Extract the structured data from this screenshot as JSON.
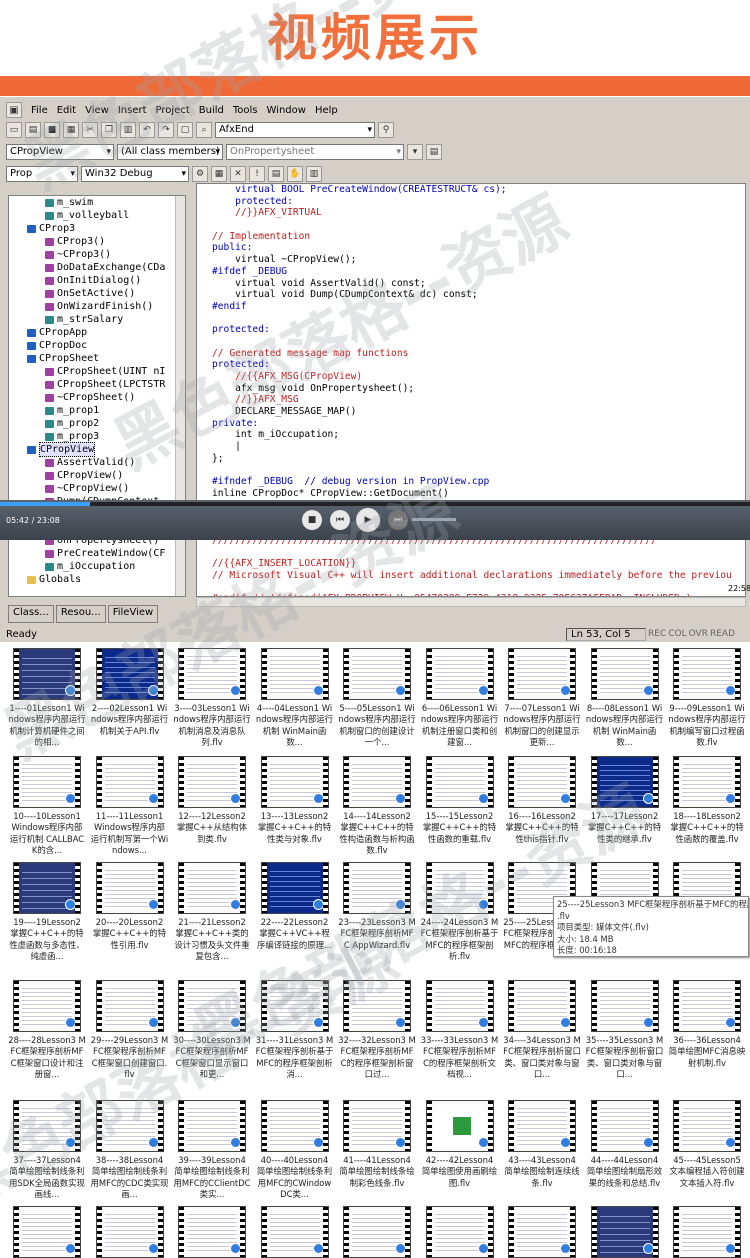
{
  "banner": {
    "title": "视频展示"
  },
  "ide": {
    "menu": [
      "File",
      "Edit",
      "View",
      "Insert",
      "Project",
      "Build",
      "Tools",
      "Window",
      "Help"
    ],
    "find_combo": "AfxEnd",
    "class_combo": "CPropView",
    "members_combo": "(All class members)",
    "function_combo": "OnPropertysheet",
    "project_combo": "Prop",
    "config_combo": "Win32 Debug",
    "tree": [
      {
        "label": "m_swim",
        "indent": 4,
        "icon": "fld"
      },
      {
        "label": "m_volleyball",
        "indent": 4,
        "icon": "fld"
      },
      {
        "label": "CProp3",
        "indent": 2,
        "icon": "cls"
      },
      {
        "label": "CProp3()",
        "indent": 4,
        "icon": "fn"
      },
      {
        "label": "~CProp3()",
        "indent": 4,
        "icon": "fn"
      },
      {
        "label": "DoDataExchange(CDa",
        "indent": 4,
        "icon": "fn"
      },
      {
        "label": "OnInitDialog()",
        "indent": 4,
        "icon": "fn"
      },
      {
        "label": "OnSetActive()",
        "indent": 4,
        "icon": "fn"
      },
      {
        "label": "OnWizardFinish()",
        "indent": 4,
        "icon": "fn"
      },
      {
        "label": "m_strSalary",
        "indent": 4,
        "icon": "fld"
      },
      {
        "label": "CPropApp",
        "indent": 2,
        "icon": "cls"
      },
      {
        "label": "CPropDoc",
        "indent": 2,
        "icon": "cls"
      },
      {
        "label": "CPropSheet",
        "indent": 2,
        "icon": "cls"
      },
      {
        "label": "CPropSheet(UINT nI",
        "indent": 4,
        "icon": "fn"
      },
      {
        "label": "CPropSheet(LPCTSTR",
        "indent": 4,
        "icon": "fn"
      },
      {
        "label": "~CPropSheet()",
        "indent": 4,
        "icon": "fn"
      },
      {
        "label": "m_prop1",
        "indent": 4,
        "icon": "fld"
      },
      {
        "label": "m_prop2",
        "indent": 4,
        "icon": "fld"
      },
      {
        "label": "m_prop3",
        "indent": 4,
        "icon": "fld"
      },
      {
        "label": "CPropView",
        "indent": 2,
        "icon": "cls",
        "selected": true
      },
      {
        "label": "AssertValid()",
        "indent": 4,
        "icon": "fn"
      },
      {
        "label": "CPropView()",
        "indent": 4,
        "icon": "fn"
      },
      {
        "label": "~CPropView()",
        "indent": 4,
        "icon": "fn"
      },
      {
        "label": "Dump(CDumpContext",
        "indent": 4,
        "icon": "fn"
      },
      {
        "label": "GetDocument()",
        "indent": 4,
        "icon": "fn"
      },
      {
        "label": "OnDraw(CDC *pDC)",
        "indent": 4,
        "icon": "fn"
      },
      {
        "label": "OnPropertysheet()",
        "indent": 4,
        "icon": "fn"
      },
      {
        "label": "PreCreateWindow(CF",
        "indent": 4,
        "icon": "fn"
      },
      {
        "label": "m_iOccupation",
        "indent": 4,
        "icon": "fld"
      },
      {
        "label": "Globals",
        "indent": 2,
        "icon": "fold"
      }
    ],
    "tabs": [
      "Class...",
      "Resou...",
      "FileView"
    ],
    "code": [
      {
        "text": "    virtual BOOL PreCreateWindow(CREATESTRUCT& cs);",
        "cls": "k"
      },
      {
        "text": "    protected:",
        "cls": "k"
      },
      {
        "text": "    //}}AFX_VIRTUAL",
        "cls": "c"
      },
      {
        "text": "",
        "cls": "t"
      },
      {
        "text": "// Implementation",
        "cls": "c"
      },
      {
        "text": "public:",
        "cls": "k"
      },
      {
        "text": "    virtual ~CPropView();",
        "cls": "t"
      },
      {
        "text": "#ifdef _DEBUG",
        "cls": "k"
      },
      {
        "text": "    virtual void AssertValid() const;",
        "cls": "t"
      },
      {
        "text": "    virtual void Dump(CDumpContext& dc) const;",
        "cls": "t"
      },
      {
        "text": "#endif",
        "cls": "k"
      },
      {
        "text": "",
        "cls": "t"
      },
      {
        "text": "protected:",
        "cls": "k"
      },
      {
        "text": "",
        "cls": "t"
      },
      {
        "text": "// Generated message map functions",
        "cls": "c"
      },
      {
        "text": "protected:",
        "cls": "k"
      },
      {
        "text": "    //{{AFX_MSG(CPropView)",
        "cls": "c"
      },
      {
        "text": "    afx_msg void OnPropertysheet();",
        "cls": "t"
      },
      {
        "text": "    //}}AFX_MSG",
        "cls": "c"
      },
      {
        "text": "    DECLARE_MESSAGE_MAP()",
        "cls": "t"
      },
      {
        "text": "private:",
        "cls": "k"
      },
      {
        "text": "    int m_iOccupation;",
        "cls": "t"
      },
      {
        "text": "    |",
        "cls": "t"
      },
      {
        "text": "};",
        "cls": "t"
      },
      {
        "text": "",
        "cls": "t"
      },
      {
        "text": "#ifndef _DEBUG  // debug version in PropView.cpp",
        "cls": "k"
      },
      {
        "text": "inline CPropDoc* CPropView::GetDocument()",
        "cls": "t"
      },
      {
        "text": "   { return (CPropDoc*)m_pDocument; }",
        "cls": "t"
      },
      {
        "text": "#endif",
        "cls": "k"
      },
      {
        "text": "",
        "cls": "t"
      },
      {
        "text": "/////////////////////////////////////////////////////////////////////////////",
        "cls": "c"
      },
      {
        "text": "",
        "cls": "t"
      },
      {
        "text": "//{{AFX_INSERT_LOCATION}}",
        "cls": "c"
      },
      {
        "text": "// Microsoft Visual C++ will insert additional declarations immediately before the previou",
        "cls": "c"
      },
      {
        "text": "",
        "cls": "t"
      },
      {
        "text": "#endif // !defined(AFX_PROPVIEW_H__05470299_E729_4318_9325_70EC37AFFBAD__INCLUDED_)",
        "cls": "c"
      }
    ],
    "player_time": "05:42 / 23:08",
    "clock": "22:58",
    "status_ready": "Ready",
    "status_pos": "Ln 53, Col 5",
    "status_flags": [
      "REC",
      "COL",
      "OVR",
      "READ"
    ]
  },
  "thumbnails": [
    {
      "caption": "1----01Lesson1 Windows程序内部运行机制计算机硬件之间的相...",
      "style": "dark"
    },
    {
      "caption": "2----02Lesson1 Windows程序内部运行机制关于API.flv",
      "style": "blue"
    },
    {
      "caption": "3----03Lesson1 Windows程序内部运行机制消息及消息队列.flv",
      "style": "plain"
    },
    {
      "caption": "4----04Lesson1 Windows程序内部运行机制 WinMain函数...",
      "style": "plain"
    },
    {
      "caption": "5----05Lesson1 Windows程序内部运行机制窗口的创建设计一个...",
      "style": "plain"
    },
    {
      "caption": "6----06Lesson1 Windows程序内部运行机制注册窗口类和创建窗...",
      "style": "plain"
    },
    {
      "caption": "7----07Lesson1 Windows程序内部运行机制窗口的创建显示更新...",
      "style": "plain"
    },
    {
      "caption": "8----08Lesson1 Windows程序内部运行机制 WinMain函数...",
      "style": "plain"
    },
    {
      "caption": "9----09Lesson1 Windows程序内部运行机制编写窗口过程函数.flv",
      "style": "plain"
    },
    {
      "caption": "10----10Lesson1 Windows程序内部运行机制 CALLBACK的含...",
      "style": "plain"
    },
    {
      "caption": "11----11Lesson1 Windows程序内部运行机制写第一个Windows...",
      "style": "plain"
    },
    {
      "caption": "12----12Lesson2 掌握C++从结构体到类.flv",
      "style": "plain"
    },
    {
      "caption": "13----13Lesson2 掌握C++C++的特性类与对象.flv",
      "style": "plain"
    },
    {
      "caption": "14----14Lesson2 掌握C++C++的特性构造函数与析构函数.flv",
      "style": "plain"
    },
    {
      "caption": "15----15Lesson2 掌握C++C++的特性函数的重载.flv",
      "style": "plain"
    },
    {
      "caption": "16----16Lesson2 掌握C++C++的特性this指针.flv",
      "style": "plain"
    },
    {
      "caption": "17----17Lesson2 掌握C++C++的特性类的继承.flv",
      "style": "blue"
    },
    {
      "caption": "18----18Lesson2 掌握C++C++的特性函数的覆盖.flv",
      "style": "plain"
    },
    {
      "caption": "19----19Lesson2 掌握C++C++的特性虚函数与多态性、纯虚函...",
      "style": "dark"
    },
    {
      "caption": "20----20Lesson2 掌握C++C++的特性引用.flv",
      "style": "plain"
    },
    {
      "caption": "21----21Lesson2 掌握C++C++类的设计习惯及头文件重复包含...",
      "style": "plain"
    },
    {
      "caption": "22----22Lesson2 掌握C++VC++程序编译链接的原理...",
      "style": "blue"
    },
    {
      "caption": "23----23Lesson3 MFC框架程序剖析MFC AppWizard.flv",
      "style": "plain"
    },
    {
      "caption": "24----24Lesson3 MFC框架程序剖析基于MFC的程序框架剖析.flv",
      "style": "plain"
    },
    {
      "caption": "25----25Lesson3 MFC框架程序剖析基于MFC的程序框架剖析",
      "style": "plain"
    },
    {
      "caption": "",
      "style": "plain"
    },
    {
      "caption": "",
      "style": "plain"
    },
    {
      "caption": "28----28Lesson3 MFC框架程序剖析MFC框架窗口设计和注册窗...",
      "style": "plain"
    },
    {
      "caption": "29----29Lesson3 MFC框架程序剖析MFC框架窗口创建窗口.flv",
      "style": "plain"
    },
    {
      "caption": "30----30Lesson3 MFC框架程序剖析MFC框架窗口显示窗口和更...",
      "style": "plain"
    },
    {
      "caption": "31----31Lesson3 MFC框架程序剖析基于MFC的程序框架剖析消...",
      "style": "plain"
    },
    {
      "caption": "32----32Lesson3 MFC框架程序剖析MFC的程序框架剖析窗口过...",
      "style": "plain"
    },
    {
      "caption": "33----33Lesson3 MFC框架程序剖析MFC的程序框架剖析文档视...",
      "style": "plain"
    },
    {
      "caption": "34----34Lesson3 MFC框架程序剖析窗口类、窗口类对象与窗口...",
      "style": "plain"
    },
    {
      "caption": "35----35Lesson3 MFC框架程序剖析窗口类、窗口类对象与窗口...",
      "style": "plain"
    },
    {
      "caption": "36----36Lesson4 简单绘图MFC消息映射机制.flv",
      "style": "plain"
    },
    {
      "caption": "37----37Lesson4 简单绘图绘制线条利用SDK全局函数实现画线...",
      "style": "plain"
    },
    {
      "caption": "38----38Lesson4 简单绘图绘制线条利用MFC的CDC类实现画...",
      "style": "plain"
    },
    {
      "caption": "39----39Lesson4 简单绘图绘制线条利用MFC的CClientDC类实...",
      "style": "plain"
    },
    {
      "caption": "40----40Lesson4 简单绘图绘制线条利用MFC的CWindowDC类...",
      "style": "plain"
    },
    {
      "caption": "41----41Lesson4 简单绘图绘制线条绘制彩色线条.flv",
      "style": "plain"
    },
    {
      "caption": "42----42Lesson4 简单绘图使用画刷绘图.flv",
      "style": "green"
    },
    {
      "caption": "43----43Lesson4 简单绘图绘制连续线条.flv",
      "style": "plain"
    },
    {
      "caption": "44----44Lesson4 简单绘图绘制扇形效果的线条和总结.flv",
      "style": "plain"
    },
    {
      "caption": "45----45Lesson5 文本编程插入符创建文本插入符.flv",
      "style": "plain"
    },
    {
      "caption": "",
      "style": "plain"
    },
    {
      "caption": "",
      "style": "plain"
    },
    {
      "caption": "",
      "style": "plain"
    },
    {
      "caption": "",
      "style": "plain"
    },
    {
      "caption": "",
      "style": "plain"
    },
    {
      "caption": "",
      "style": "plain"
    },
    {
      "caption": "",
      "style": "plain"
    },
    {
      "caption": "",
      "style": "dark"
    },
    {
      "caption": "",
      "style": "plain"
    }
  ],
  "tooltip": {
    "lines": [
      "25----25Lesson3 MFC框架程序剖析基于MFC的程序",
      ".flv",
      "项目类型: 媒体文件(.flv)",
      "大小: 18.4 MB",
      "长度: 00:16:18"
    ]
  },
  "watermark": {
    "text": "黑色部落格--资源",
    "color": "#9aa0a8"
  }
}
